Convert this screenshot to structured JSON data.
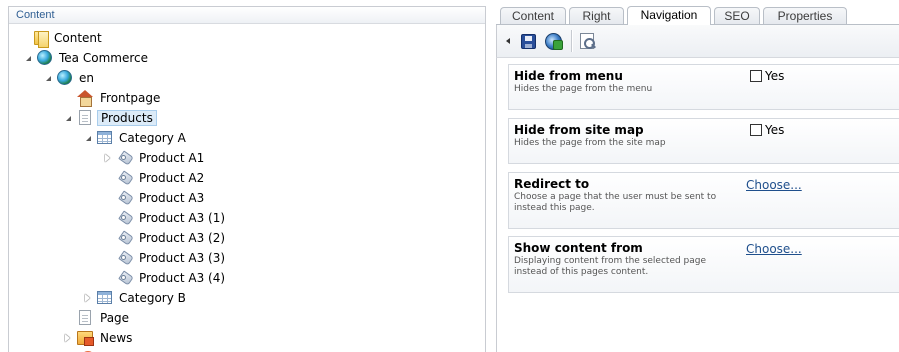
{
  "tree": {
    "header": "Content",
    "items": [
      {
        "label": "Content",
        "icon": "folder-icon",
        "arrow": "none"
      },
      {
        "label": "Tea Commerce",
        "icon": "globe-icon",
        "arrow": "expanded"
      },
      {
        "label": "en",
        "icon": "globe-icon",
        "arrow": "expanded"
      },
      {
        "label": "Frontpage",
        "icon": "home-icon",
        "arrow": "none"
      },
      {
        "label": "Products",
        "icon": "page-icon",
        "arrow": "expanded",
        "selected": true
      },
      {
        "label": "Category A",
        "icon": "grid-icon",
        "arrow": "expanded"
      },
      {
        "label": "Product A1",
        "icon": "tag-icon",
        "arrow": "collapsed"
      },
      {
        "label": "Product A2",
        "icon": "tag-icon",
        "arrow": "none"
      },
      {
        "label": "Product A3",
        "icon": "tag-icon",
        "arrow": "none"
      },
      {
        "label": "Product A3 (1)",
        "icon": "tag-icon",
        "arrow": "none"
      },
      {
        "label": "Product A3 (2)",
        "icon": "tag-icon",
        "arrow": "none"
      },
      {
        "label": "Product A3 (3)",
        "icon": "tag-icon",
        "arrow": "none"
      },
      {
        "label": "Product A3 (4)",
        "icon": "tag-icon",
        "arrow": "none"
      },
      {
        "label": "Category B",
        "icon": "grid-icon",
        "arrow": "collapsed"
      },
      {
        "label": "Page",
        "icon": "page-icon",
        "arrow": "none"
      },
      {
        "label": "News",
        "icon": "news-icon",
        "arrow": "collapsed"
      }
    ]
  },
  "tabs": [
    {
      "label": "Content"
    },
    {
      "label": "Right"
    },
    {
      "label": "Navigation",
      "active": true
    },
    {
      "label": "SEO"
    },
    {
      "label": "Properties"
    }
  ],
  "toolbar": {
    "icons": [
      "collapse-arrow-icon",
      "save-icon",
      "save-and-publish-icon",
      "preview-icon"
    ]
  },
  "properties": [
    {
      "title": "Hide from menu",
      "description": "Hides the page from the menu",
      "control": "checkbox",
      "value": "Yes"
    },
    {
      "title": "Hide from site map",
      "description": "Hides the page from the site map",
      "control": "checkbox",
      "value": "Yes"
    },
    {
      "title": "Redirect to",
      "description": "Choose a page that the user must be sent to instead this page.",
      "control": "link",
      "value": "Choose..."
    },
    {
      "title": "Show content from",
      "description": "Displaying content from the selected page instead of this pages content.",
      "control": "link",
      "value": "Choose..."
    }
  ],
  "colors": {
    "selected_bg": "#dcebf8",
    "link": "#1f4f8c",
    "header_text": "#305f93"
  }
}
